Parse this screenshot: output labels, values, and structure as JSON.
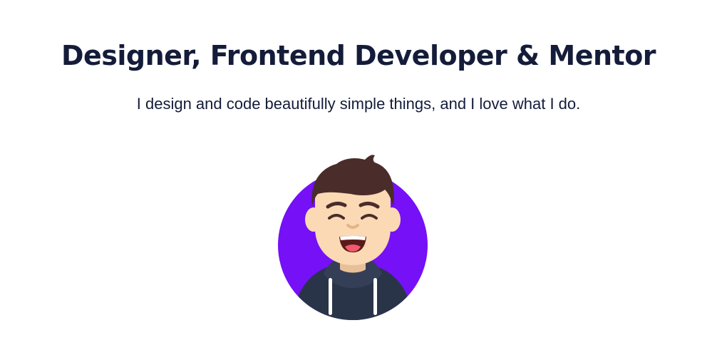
{
  "hero": {
    "headline": "Designer, Frontend Developer & Mentor",
    "tagline": "I design and code beautifully simple things, and I love what I do."
  },
  "colors": {
    "heading": "#141c3a",
    "accent_circle": "#7510f7",
    "hair": "#4a2c2a",
    "skin": "#fad9b4",
    "hoodie": "#2a3449",
    "drawstring": "#ffffff",
    "mouth": "#5a1a1a",
    "tongue": "#f05a6e"
  },
  "avatar": {
    "icon": "developer-avatar-illustration"
  }
}
